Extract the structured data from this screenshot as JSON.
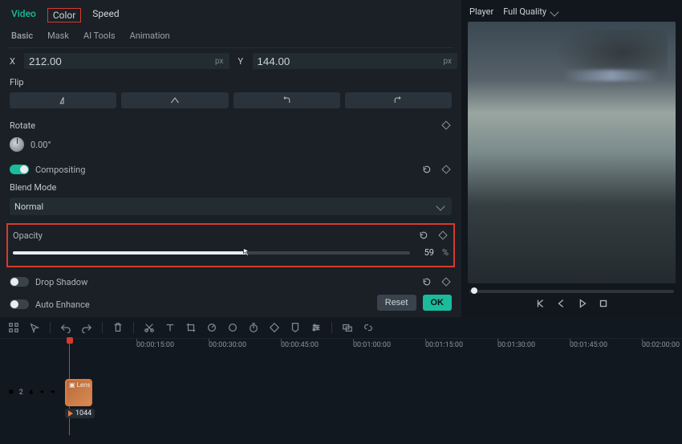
{
  "tabs": {
    "video": "Video",
    "color": "Color",
    "speed": "Speed"
  },
  "subtabs": {
    "basic": "Basic",
    "mask": "Mask",
    "aitools": "AI Tools",
    "animation": "Animation"
  },
  "coords": {
    "x_label": "X",
    "x_value": "212.00",
    "x_unit": "px",
    "y_label": "Y",
    "y_value": "144.00",
    "y_unit": "px"
  },
  "flip": {
    "label": "Flip"
  },
  "rotate": {
    "label": "Rotate",
    "value": "0.00°"
  },
  "compositing": {
    "label": "Compositing",
    "on": true
  },
  "blend": {
    "label": "Blend Mode",
    "value": "Normal"
  },
  "opacity": {
    "label": "Opacity",
    "value": "59",
    "unit": "%",
    "percent": 59
  },
  "dropshadow": {
    "label": "Drop Shadow",
    "on": false
  },
  "autoenhance": {
    "label": "Auto Enhance",
    "on": false
  },
  "buttons": {
    "reset": "Reset",
    "ok": "OK"
  },
  "player": {
    "label": "Player",
    "quality": "Full Quality"
  },
  "timeline": {
    "ticks": [
      "00:00:15:00",
      "00:00:30:00",
      "00:00:45:00",
      "00:01:00:00",
      "00:01:15:00",
      "00:01:30:00",
      "00:01:45:00",
      "00:02:00:00"
    ],
    "track_nums": [
      "2"
    ],
    "clip1": "Lens",
    "clip2": "1044"
  }
}
